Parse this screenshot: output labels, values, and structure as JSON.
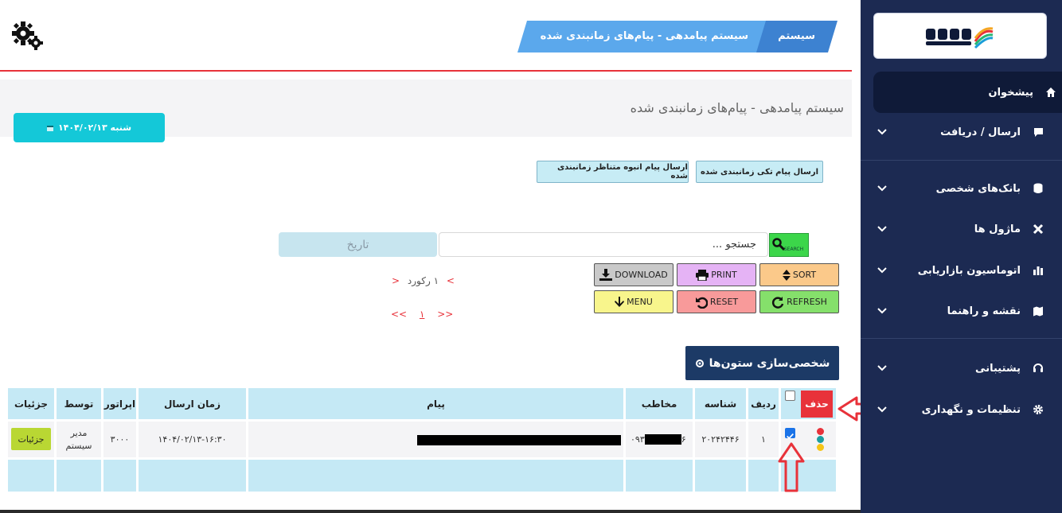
{
  "header": {
    "breadcrumb_root": "سیستم",
    "breadcrumb_current": "سیستم پیامدهی - پیام‌های زمانبندی شده"
  },
  "page": {
    "title": "سیستم پیامدهی - پیام‌های زمانبندی شده",
    "date_label": "شنبه ۱۴۰۴/۰۲/۱۳"
  },
  "actions": {
    "single_label": "ارسال پیام تکی زمانبندی شده",
    "bulk_label": "ارسال پیام انبوه متناظر زمانبندی شده"
  },
  "search": {
    "date_placeholder": "تاریخ",
    "search_placeholder": "جستجو ...",
    "search_button": "SEARCH"
  },
  "tools": {
    "sort": "SORT",
    "print": "PRINT",
    "download": "DOWNLOAD",
    "refresh": "REFRESH",
    "reset": "RESET",
    "menu": "MENU"
  },
  "pager": {
    "records": "۱ رکورد",
    "prev": ">",
    "next": "<",
    "first": "<<",
    "last": ">>",
    "page": "۱"
  },
  "customize_label": "شخصی‌سازی ستون‌ها",
  "table": {
    "delete_label": "حذف",
    "headers": {
      "row": "ردیف",
      "id": "شناسه",
      "recipient": "مخاطب",
      "message": "پیام",
      "send_time": "زمان ارسال",
      "operator": "اپراتور",
      "by": "توسط",
      "details": "جزئیات"
    },
    "rows": [
      {
        "row": "۱",
        "id": "۲۰۲۴۲۴۴۶",
        "recipient_prefix": "۰۹۳",
        "recipient_suffix": "۶",
        "send_time": "۱۴۰۴/۰۲/۱۳-۱۶:۳۰",
        "operator": "۳۰۰۰",
        "by_line1": "مدیر",
        "by_line2": "سیستم",
        "details_button": "جزئیات"
      }
    ]
  },
  "sidebar": {
    "items": [
      {
        "label": "پیشخوان",
        "icon": "home-icon"
      },
      {
        "label": "ارسال / دریافت",
        "icon": "message-icon"
      },
      {
        "label": "بانک‌های شخصی",
        "icon": "database-icon"
      },
      {
        "label": "ماژول ها",
        "icon": "tools-icon"
      },
      {
        "label": "اتوماسیون بازاریابی",
        "icon": "chart-icon"
      },
      {
        "label": "نقشه و راهنما",
        "icon": "map-icon"
      },
      {
        "label": "پشتیبانی",
        "icon": "headset-icon"
      },
      {
        "label": "تنظیمات و نگهداری",
        "icon": "gear-icon"
      }
    ]
  },
  "colors": {
    "sidebar_bg": "#1c2a52",
    "accent_red": "#e8323a",
    "table_header": "#c5e9f5",
    "date_button": "#14c8d8"
  }
}
